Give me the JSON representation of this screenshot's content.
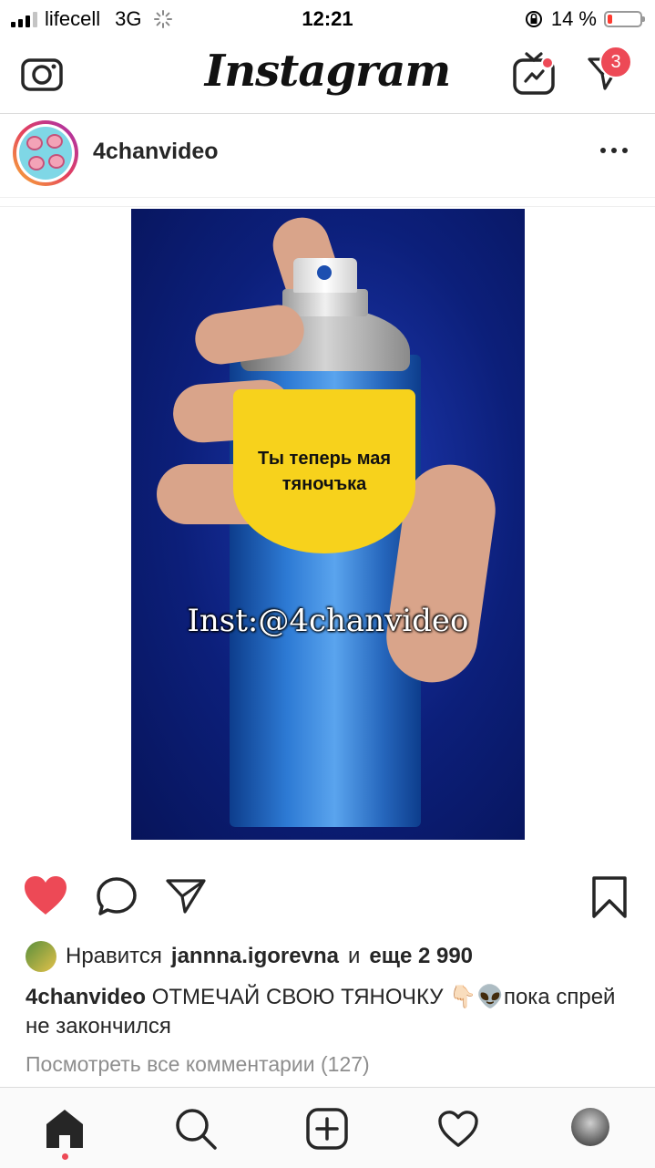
{
  "status_bar": {
    "carrier": "lifecell",
    "network": "3G",
    "time": "12:21",
    "battery_percent_label": "14 %",
    "battery_level": 0.14
  },
  "top_nav": {
    "logo": "Instagram",
    "direct_badge": "3"
  },
  "post": {
    "username": "4chanvideo",
    "image": {
      "label_text": "Ты теперь мая тяночъка",
      "watermark": "Inst:@4chanvideo"
    },
    "likes": {
      "prefix": "Нравится",
      "user": "jannna.igorevna",
      "connector": "и",
      "others": "еще 2 990"
    },
    "caption": {
      "username": "4chanvideo",
      "text": "ОТМЕЧАЙ СВОЮ ТЯНОЧКУ 👇🏻👽пока спрей не закончился"
    },
    "view_comments": "Посмотреть все комментарии (127)"
  },
  "colors": {
    "like_red": "#ed4956",
    "badge_red": "#ed4956",
    "text": "#262626",
    "muted": "#8e8e8e"
  },
  "icons": {
    "camera": "camera-icon",
    "igtv": "igtv-icon",
    "direct": "paper-plane-icon",
    "more": "more-dots-icon",
    "like": "heart-filled-icon",
    "comment": "comment-bubble-icon",
    "share": "paper-plane-icon",
    "save": "bookmark-icon",
    "home": "home-icon",
    "search": "search-icon",
    "add": "add-post-icon",
    "activity": "heart-outline-icon"
  }
}
